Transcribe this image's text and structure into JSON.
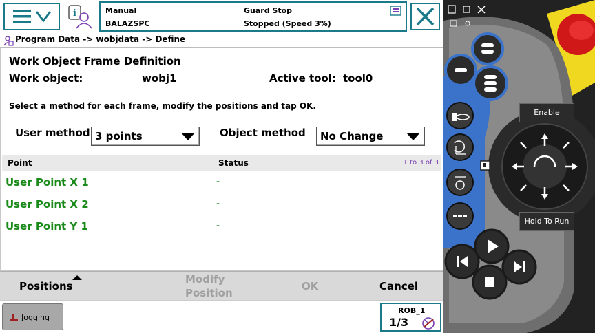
{
  "status": {
    "mode": "Manual",
    "controller": "BALAZSPC",
    "guard": "Guard Stop",
    "state": "Stopped (Speed 3%)"
  },
  "breadcrumb": "Program Data -> wobjdata -> Define",
  "form": {
    "title": "Work Object Frame Definition",
    "work_object_label": "Work object:",
    "work_object_value": "wobj1",
    "active_tool_label": "Active tool:",
    "active_tool_value": "tool0",
    "instruction": "Select a method for each frame, modify the positions and tap OK.",
    "user_method_label": "User method",
    "user_method_value": "3 points",
    "object_method_label": "Object method",
    "object_method_value": "No Change"
  },
  "grid": {
    "col_point": "Point",
    "col_status": "Status",
    "paging": "1 to 3 of 3",
    "rows": [
      {
        "point": "User Point X 1",
        "status": "-"
      },
      {
        "point": "User Point X 2",
        "status": "-"
      },
      {
        "point": "User Point Y 1",
        "status": "-"
      }
    ]
  },
  "commands": {
    "positions": "Positions",
    "modify_line1": "Modify",
    "modify_line2": "Position",
    "ok": "OK",
    "cancel": "Cancel"
  },
  "taskbar": {
    "jogging": "Jogging",
    "rob": "ROB_1",
    "fraction": "1/3"
  },
  "pendant": {
    "enable": "Enable",
    "hold_to_run": "Hold To Run"
  },
  "colors": {
    "accent": "#1a7a8a",
    "ok_text": "#1a8a1a",
    "paging": "#7a3fb0",
    "pendant_blue": "#3a73c9",
    "emergency_red": "#d01818",
    "pendant_yellow": "#f0d820"
  }
}
